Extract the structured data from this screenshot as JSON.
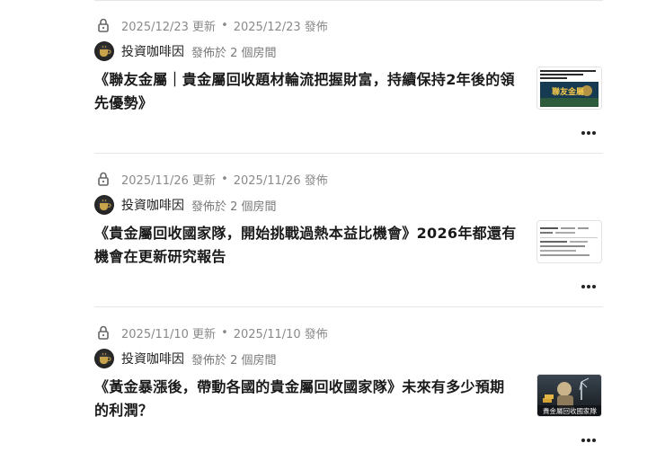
{
  "posts": [
    {
      "updated": "2025/12/23 更新",
      "published": "2025/12/23 發佈",
      "author": "投資咖啡因",
      "room": "發佈於 2 個房間",
      "title": "《聯友金屬｜貴金屬回收題材輪流把握財富，持續保持2年後的領先優勢》",
      "thumb_text": "聯友金屬"
    },
    {
      "updated": "2025/11/26 更新",
      "published": "2025/11/26 發佈",
      "author": "投資咖啡因",
      "room": "發佈於 2 個房間",
      "title": "《貴金屬回收國家隊，開始挑戰過熱本益比機會》2026年都還有機會在更新研究報告"
    },
    {
      "updated": "2025/11/10 更新",
      "published": "2025/11/10 發佈",
      "author": "投資咖啡因",
      "room": "發佈於 2 個房間",
      "title": "《黃金暴漲後，帶動各國的貴金屬回收國家隊》未來有多少預期的利潤？",
      "thumb_text": "貴金屬回收國家隊"
    }
  ],
  "separator": "•",
  "icons": {
    "lock": "lock-icon",
    "more": "more-options-icon"
  },
  "colors": {
    "meta": "#8a8a8a",
    "divider": "#e6e6e6",
    "title": "#1a1a1a"
  }
}
